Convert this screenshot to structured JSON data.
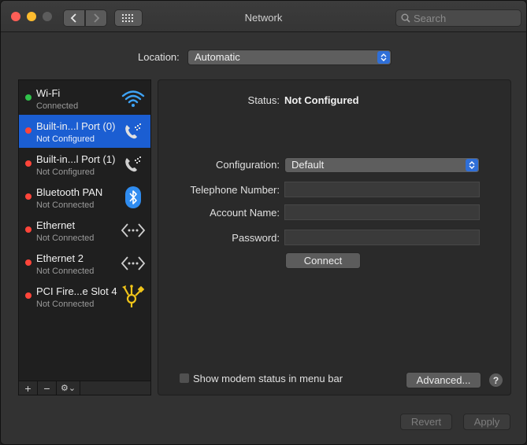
{
  "window": {
    "title": "Network"
  },
  "search": {
    "placeholder": "Search"
  },
  "location": {
    "label": "Location:",
    "value": "Automatic"
  },
  "services": [
    {
      "name": "Wi-Fi",
      "status": "Connected",
      "status_color": "#30c24a",
      "icon": "wifi-icon",
      "selected": false
    },
    {
      "name": "Built-in...l Port (0)",
      "status": "Not Configured",
      "status_color": "#ff453a",
      "icon": "phone-modem-icon",
      "selected": true
    },
    {
      "name": "Built-in...l Port (1)",
      "status": "Not Configured",
      "status_color": "#ff453a",
      "icon": "phone-modem-icon",
      "selected": false
    },
    {
      "name": "Bluetooth PAN",
      "status": "Not Connected",
      "status_color": "#ff453a",
      "icon": "bluetooth-icon",
      "selected": false
    },
    {
      "name": "Ethernet",
      "status": "Not Connected",
      "status_color": "#ff453a",
      "icon": "ethernet-icon",
      "selected": false
    },
    {
      "name": "Ethernet 2",
      "status": "Not Connected",
      "status_color": "#ff453a",
      "icon": "ethernet-icon",
      "selected": false
    },
    {
      "name": "PCI Fire...e Slot  4",
      "status": "Not Connected",
      "status_color": "#ff453a",
      "icon": "firewire-icon",
      "selected": false
    }
  ],
  "sidebar_footer": {
    "add": "+",
    "remove": "−",
    "gear": "⚙︎⌄"
  },
  "detail": {
    "status_label": "Status:",
    "status_value": "Not Configured",
    "configuration_label": "Configuration:",
    "configuration_value": "Default",
    "telephone_label": "Telephone Number:",
    "telephone_value": "",
    "account_label": "Account Name:",
    "account_value": "",
    "password_label": "Password:",
    "password_value": "",
    "connect_label": "Connect",
    "show_modem_label": "Show modem status in menu bar",
    "show_modem_checked": false,
    "advanced_label": "Advanced...",
    "help_label": "?"
  },
  "footer": {
    "revert_label": "Revert",
    "apply_label": "Apply"
  },
  "colors": {
    "accent": "#1b5ed2",
    "connected": "#30c24a",
    "disconnected": "#ff453a",
    "firewire": "#f0c419"
  }
}
